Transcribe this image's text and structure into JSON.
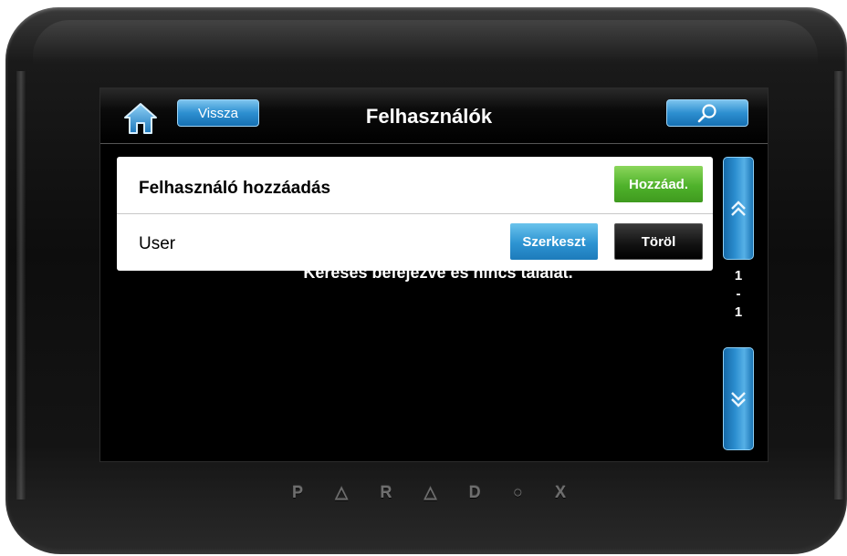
{
  "header": {
    "home_icon": "home-icon",
    "back_label": "Vissza",
    "title": "Felhasználók",
    "search_icon": "search-icon"
  },
  "background_message": "Keresés befejezve és nincs találat.",
  "panel": {
    "add_row": {
      "label": "Felhasználó hozzáadás",
      "add_button": "Hozzáad."
    },
    "user_row": {
      "label": "User",
      "edit_button": "Szerkeszt",
      "delete_button": "Töröl"
    }
  },
  "pager": {
    "current": "1",
    "separator": "-",
    "total": "1",
    "up_icon": "chevron-up-icon",
    "down_icon": "chevron-down-icon"
  },
  "brand": {
    "letters": [
      "P",
      "△",
      "R",
      "△",
      "D",
      "○",
      "X"
    ]
  },
  "colors": {
    "accent_blue": "#2d8fd0",
    "add_green": "#4fb22b",
    "delete_black": "#111111",
    "screen_bg": "#000000"
  }
}
